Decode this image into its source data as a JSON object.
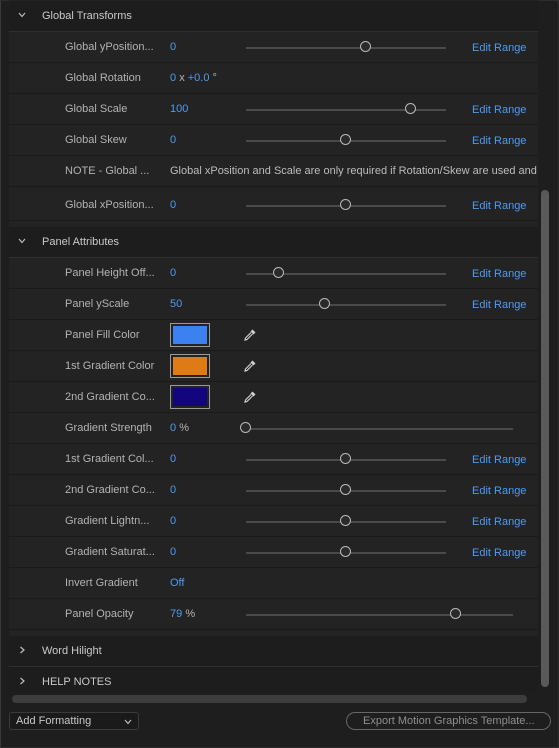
{
  "sections": {
    "global_transforms": {
      "title": "Global Transforms",
      "rows": [
        {
          "label": "Global yPosition...",
          "value": "0",
          "edit": "Edit Range",
          "slider": 0.6
        },
        {
          "label": "Global Rotation",
          "value_a": "0",
          "value_x": "x",
          "value_b": "+0.0",
          "unit": "°"
        },
        {
          "label": "Global Scale",
          "value": "100",
          "edit": "Edit Range",
          "slider": 0.83
        },
        {
          "label": "Global Skew",
          "value": "0",
          "edit": "Edit Range",
          "slider": 0.5
        },
        {
          "label": "NOTE - Global ...",
          "note": "Global xPosition and Scale are only required if Rotation/Skew are used and you"
        },
        {
          "label": "Global xPosition...",
          "value": "0",
          "edit": "Edit Range",
          "slider": 0.5
        }
      ]
    },
    "panel_attributes": {
      "title": "Panel Attributes",
      "rows": [
        {
          "label": "Panel Height Off...",
          "value": "0",
          "edit": "Edit Range",
          "slider": 0.16
        },
        {
          "label": "Panel yScale",
          "value": "50",
          "edit": "Edit Range",
          "slider": 0.4
        },
        {
          "label": "Panel Fill Color",
          "color": "#3b82f0"
        },
        {
          "label": "1st Gradient Color",
          "color": "#e07a14"
        },
        {
          "label": "2nd Gradient Co...",
          "color": "#12057e"
        },
        {
          "label": "Gradient Strength",
          "value": "0",
          "unit": "%",
          "slider": 0.0
        },
        {
          "label": "1st Gradient Col...",
          "value": "0",
          "edit": "Edit Range",
          "slider": 0.5
        },
        {
          "label": "2nd Gradient Co...",
          "value": "0",
          "edit": "Edit Range",
          "slider": 0.5
        },
        {
          "label": "Gradient Lightn...",
          "value": "0",
          "edit": "Edit Range",
          "slider": 0.5
        },
        {
          "label": "Gradient Saturat...",
          "value": "0",
          "edit": "Edit Range",
          "slider": 0.5
        },
        {
          "label": "Invert Gradient",
          "value": "Off"
        },
        {
          "label": "Panel Opacity",
          "value": "79",
          "unit": "%",
          "slider": 0.79
        }
      ]
    },
    "word_hilight": {
      "title": "Word Hilight"
    },
    "help_notes": {
      "title": "HELP NOTES"
    }
  },
  "footer": {
    "add_formatting": "Add Formatting",
    "export": "Export Motion Graphics Template..."
  }
}
